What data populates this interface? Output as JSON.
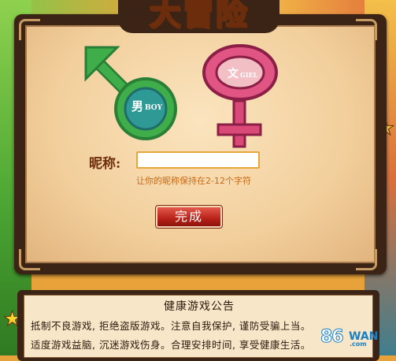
{
  "game": {
    "logo_text": "大冒险"
  },
  "gender": {
    "male_label": "男",
    "male_en": "BOY",
    "female_label": "文",
    "female_en": "GIEL",
    "male_color": "#3aa24a",
    "female_color": "#d94a78"
  },
  "form": {
    "nickname_label": "昵称:",
    "nickname_value": "",
    "hint": "让你的昵称保持在2-12个字符",
    "submit_label": "完成"
  },
  "notice": {
    "title": "健康游戏公告",
    "line1": "抵制不良游戏, 拒绝盗版游戏。注意自我保护, 谨防受骗上当。",
    "line2": "适度游戏益脑, 沉迷游戏伤身。合理安排时间, 享受健康生活。"
  },
  "watermark": {
    "number": "86",
    "brand": "WAN",
    "domain": ".com"
  }
}
